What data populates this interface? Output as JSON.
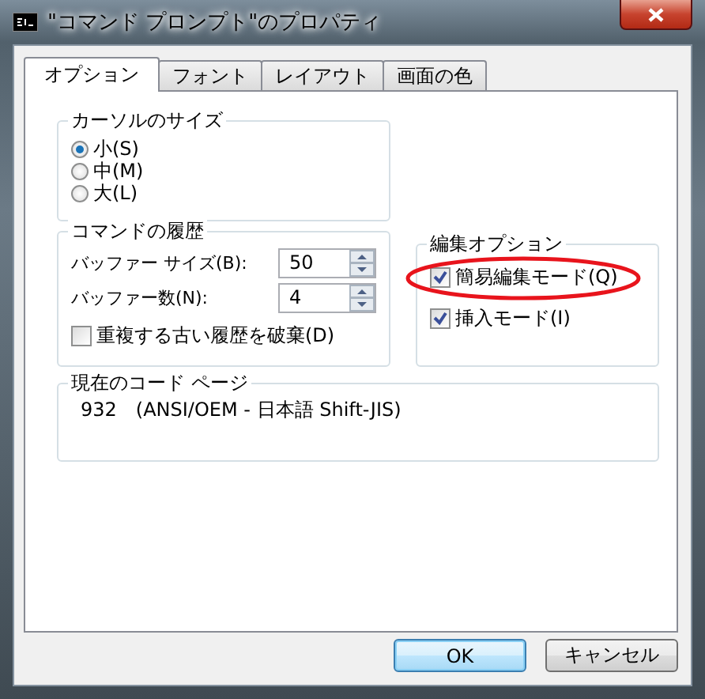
{
  "window": {
    "title": "\"コマンド プロンプト\"のプロパティ"
  },
  "tabs": [
    {
      "label": "オプション",
      "selected": true
    },
    {
      "label": "フォント",
      "selected": false
    },
    {
      "label": "レイアウト",
      "selected": false
    },
    {
      "label": "画面の色",
      "selected": false
    }
  ],
  "cursor_size": {
    "label": "カーソルのサイズ",
    "options": [
      {
        "label": "小(S)",
        "selected": true
      },
      {
        "label": "中(M)",
        "selected": false
      },
      {
        "label": "大(L)",
        "selected": false
      }
    ]
  },
  "command_history": {
    "label": "コマンドの履歴",
    "fields": [
      {
        "label": "バッファー サイズ(B):",
        "value": "50"
      },
      {
        "label": "バッファー数(N):",
        "value": "4"
      }
    ],
    "discard_duplicates": {
      "label": "重複する古い履歴を破棄(D)",
      "checked": false
    }
  },
  "edit_options": {
    "label": "編集オプション",
    "options": [
      {
        "label": "簡易編集モード(Q)",
        "checked": true
      },
      {
        "label": "挿入モード(I)",
        "checked": true
      }
    ]
  },
  "code_page": {
    "label": "現在のコード ページ",
    "value": "932　(ANSI/OEM - 日本語 Shift-JIS)"
  },
  "buttons": [
    {
      "label": "OK",
      "default": true
    },
    {
      "label": "キャンセル",
      "default": false
    }
  ],
  "annotation": {
    "kind": "ellipse",
    "color": "#e8141c"
  }
}
